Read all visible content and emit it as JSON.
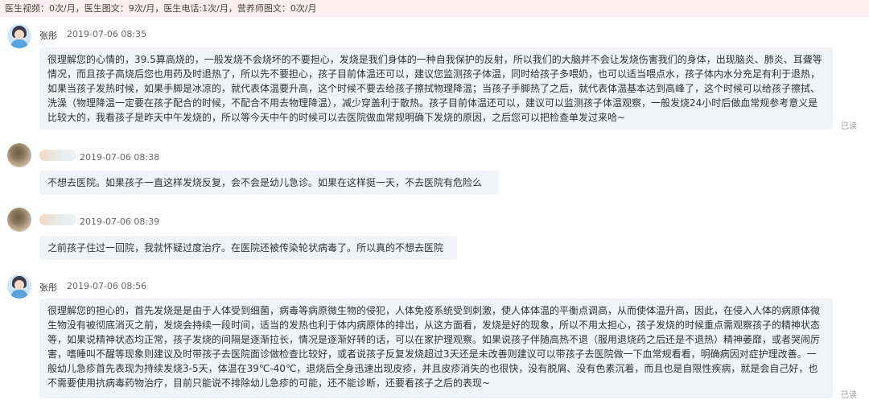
{
  "header": {
    "stats": "医生视频：0次/月，医生图文：9次/月，医生电话:1次/月，营养师图文：0次/月"
  },
  "messages": [
    {
      "sender": "张彤",
      "time": "2019-07-06 08:35",
      "text": "很理解您的心情的，39.5算高烧的，一般发烧不会烧坏的不要担心，发烧是我们身体的一种自我保护的反射，所以我们的大脑并不会让发烧伤害我们的身体，出现脑炎、肺炎、耳聋等情况，而且孩子高烧后您也用药及时退热了，所以先不要担心，孩子目前体温还可以，建议您监测孩子体温，同时给孩子多喂奶，也可以适当喂点水，孩子体内水分充足有利于退热，如果当孩子发热时候，如果手脚是冰凉的，就代表体温要升高，这个时候不要去给孩子擦拭物理降温；当孩子手脚热了之后，就代表体温基本达到高峰了，这个时候可以给孩子擦拭、洗澡（物理降温一定要在孩子配合的时候，不配合不用去物理降温），减少穿盖利于散热。孩子目前体温还可以，建议可以监测孩子体温观察，一般发烧24小时后做血常规参考意义是比较大的，我看孩子是昨天中午发烧的，所以等今天中午的时候可以去医院做血常规明确下发烧的原因，之后您可以把检查单发过来哈~",
      "status": "已读"
    },
    {
      "sender": "",
      "time": "2019-07-06 08:38",
      "text": "不想去医院。如果孩子一直这样发烧反复，会不会是幼儿急诊。如果在这样挺一天，不去医院有危险么",
      "status": ""
    },
    {
      "sender": "",
      "time": "2019-07-06 08:39",
      "text": "之前孩子住过一回院，我就怀疑过度治疗。在医院还被传染轮状病毒了。所以真的不想去医院",
      "status": ""
    },
    {
      "sender": "张彤",
      "time": "2019-07-06 08:56",
      "text": "很理解您的担心的，首先发烧是是由于人体受到细菌，病毒等病原微生物的侵犯，人体免疫系统受到刺激，使人体体温的平衡点调高，从而使体温升高，因此，在侵入人体的病原体微生物没有被彻底消灭之前，发烧会持续一段时间，适当的发热也利于体内病原体的排出，从这方面看，发烧是好的现象，所以不用太担心，孩子发烧的时候重点需观察孩子的精神状态等，如果说精神状态均正常，孩子发烧的间隔是逐渐拉长，情况是逐渐好转的话，可以在家护理观察。如果说孩子伴随高热不退（服用退烧药之后还是不退热）精神萎靡，或者哭闹厉害，嗜睡叫不醒等现象则建议及时带孩子去医院面诊做检查比较好，或者说孩子反复发烧超过3天还是未改善则建议可以带孩子去医院做一下血常规看看，明确病因对症护理改善。一般幼儿急疹首先表现为持续发烧3-5天，体温在39℃-40℃，退烧后全身迅速出现皮疹，并且皮疹消失的也很快，没有脱屑、没有色素沉着，而且也是自限性疾病，就是会自己好，也不需要使用抗病毒药物治疗，目前只能说不排除幼儿急疹的可能，还不能诊断，还要看孩子之后的表现~",
      "status": "已读"
    }
  ]
}
